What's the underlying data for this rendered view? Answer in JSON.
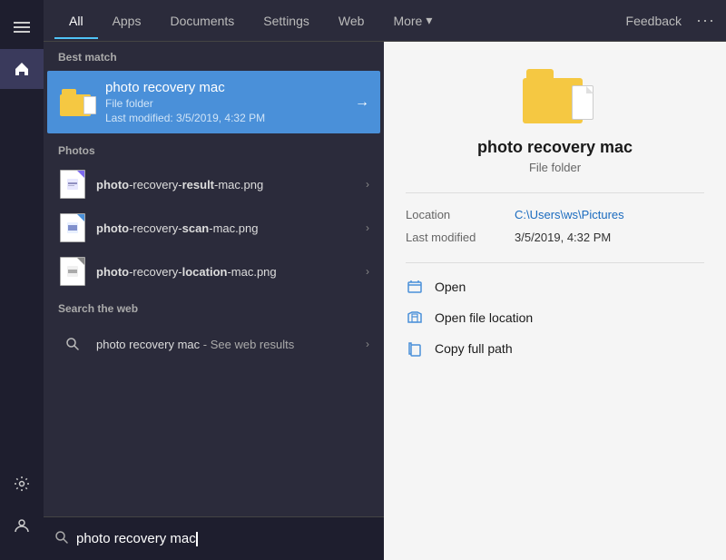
{
  "sidebar": {
    "hamburger_icon": "☰",
    "home_icon": "⌂",
    "settings_icon": "⚙",
    "user_icon": "👤"
  },
  "tabs": {
    "items": [
      {
        "label": "All",
        "active": true
      },
      {
        "label": "Apps",
        "active": false
      },
      {
        "label": "Documents",
        "active": false
      },
      {
        "label": "Settings",
        "active": false
      },
      {
        "label": "Web",
        "active": false
      },
      {
        "label": "More",
        "active": false
      }
    ],
    "more_chevron": "▾",
    "feedback_label": "Feedback",
    "dots_label": "···"
  },
  "left_panel": {
    "best_match_label": "Best match",
    "best_match": {
      "title": "photo recovery mac",
      "subtitle": "File folder",
      "last_modified": "Last modified: 3/5/2019, 4:32 PM",
      "arrow": "→"
    },
    "photos_section": "Photos",
    "photo_items": [
      {
        "name": "photo-recovery-result-mac",
        "ext": ".png",
        "bold_parts": [
          "photo",
          "-recovery-",
          "result",
          "-mac"
        ]
      },
      {
        "name": "photo-recovery-scan-mac",
        "ext": ".png"
      },
      {
        "name": "photo-recovery-location-mac",
        "ext": ".png"
      }
    ],
    "photo_display": [
      {
        "prefix": "photo",
        "middle": "-recovery-result-mac",
        "suffix": ".png"
      },
      {
        "prefix": "photo",
        "middle": "-recovery-scan-mac",
        "suffix": ".png"
      },
      {
        "prefix": "photo",
        "middle": "-recovery-location-mac",
        "suffix": ".png"
      }
    ],
    "web_section": "Search the web",
    "web_query": "photo recovery mac",
    "web_see_results": " - See web results",
    "chevron": "›"
  },
  "right_panel": {
    "title": "photo recovery mac",
    "type": "File folder",
    "location_label": "Location",
    "location_value": "C:\\Users\\ws\\Pictures",
    "last_modified_label": "Last modified",
    "last_modified_value": "3/5/2019, 4:32 PM",
    "actions": [
      {
        "label": "Open",
        "icon": "open"
      },
      {
        "label": "Open file location",
        "icon": "location"
      },
      {
        "label": "Copy full path",
        "icon": "copy"
      }
    ]
  },
  "search_bar": {
    "placeholder": "photo recovery mac",
    "value": "photo recovery mac"
  }
}
